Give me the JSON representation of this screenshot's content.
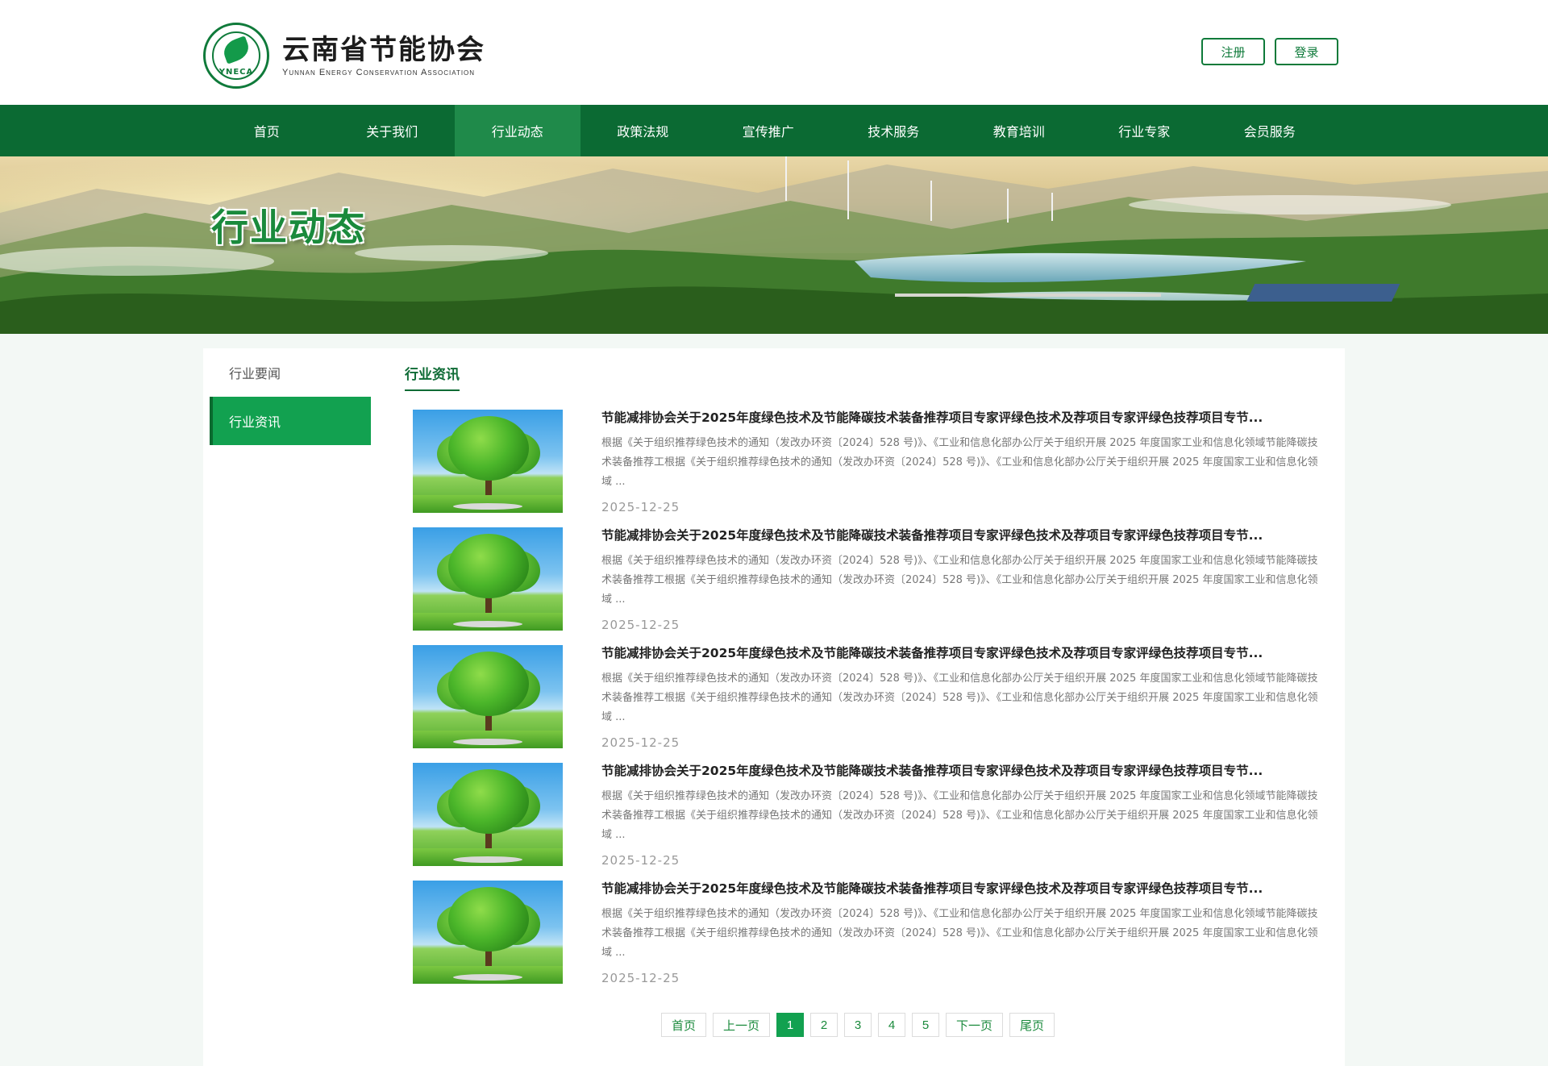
{
  "header": {
    "org_name": "云南省节能协会",
    "org_name_en": "Yunnan Energy Conservation Association",
    "seal_abbr": "YNECA",
    "seal_text": "云南省节能协会",
    "register_label": "注册",
    "login_label": "登录"
  },
  "nav": {
    "items": [
      {
        "label": "首页"
      },
      {
        "label": "关于我们"
      },
      {
        "label": "行业动态"
      },
      {
        "label": "政策法规"
      },
      {
        "label": "宣传推广"
      },
      {
        "label": "技术服务"
      },
      {
        "label": "教育培训"
      },
      {
        "label": "行业专家"
      },
      {
        "label": "会员服务"
      }
    ],
    "active_index": 2
  },
  "banner": {
    "title": "行业动态"
  },
  "sidebar": {
    "items": [
      {
        "label": "行业要闻"
      },
      {
        "label": "行业资讯"
      }
    ],
    "active_index": 1
  },
  "main": {
    "section_title": "行业资讯",
    "articles": [
      {
        "title": "节能减排协会关于2025年度绿色技术及节能降碳技术装备推荐项目专家评绿色技术及荐项目专家评绿色技荐项目专节...",
        "summary": "根据《关于组织推荐绿色技术的通知（发改办环资〔2024〕528 号)》、《工业和信息化部办公厅关于组织开展 2025 年度国家工业和信息化领域节能降碳技术装备推荐工根据《关于组织推荐绿色技术的通知（发改办环资〔2024〕528 号)》、《工业和信息化部办公厅关于组织开展 2025 年度国家工业和信息化领域 ...",
        "date": "2025-12-25"
      },
      {
        "title": "节能减排协会关于2025年度绿色技术及节能降碳技术装备推荐项目专家评绿色技术及荐项目专家评绿色技荐项目专节...",
        "summary": "根据《关于组织推荐绿色技术的通知（发改办环资〔2024〕528 号)》、《工业和信息化部办公厅关于组织开展 2025 年度国家工业和信息化领域节能降碳技术装备推荐工根据《关于组织推荐绿色技术的通知（发改办环资〔2024〕528 号)》、《工业和信息化部办公厅关于组织开展 2025 年度国家工业和信息化领域 ...",
        "date": "2025-12-25"
      },
      {
        "title": "节能减排协会关于2025年度绿色技术及节能降碳技术装备推荐项目专家评绿色技术及荐项目专家评绿色技荐项目专节...",
        "summary": "根据《关于组织推荐绿色技术的通知（发改办环资〔2024〕528 号)》、《工业和信息化部办公厅关于组织开展 2025 年度国家工业和信息化领域节能降碳技术装备推荐工根据《关于组织推荐绿色技术的通知（发改办环资〔2024〕528 号)》、《工业和信息化部办公厅关于组织开展 2025 年度国家工业和信息化领域 ...",
        "date": "2025-12-25"
      },
      {
        "title": "节能减排协会关于2025年度绿色技术及节能降碳技术装备推荐项目专家评绿色技术及荐项目专家评绿色技荐项目专节...",
        "summary": "根据《关于组织推荐绿色技术的通知（发改办环资〔2024〕528 号)》、《工业和信息化部办公厅关于组织开展 2025 年度国家工业和信息化领域节能降碳技术装备推荐工根据《关于组织推荐绿色技术的通知（发改办环资〔2024〕528 号)》、《工业和信息化部办公厅关于组织开展 2025 年度国家工业和信息化领域 ...",
        "date": "2025-12-25"
      },
      {
        "title": "节能减排协会关于2025年度绿色技术及节能降碳技术装备推荐项目专家评绿色技术及荐项目专家评绿色技荐项目专节...",
        "summary": "根据《关于组织推荐绿色技术的通知（发改办环资〔2024〕528 号)》、《工业和信息化部办公厅关于组织开展 2025 年度国家工业和信息化领域节能降碳技术装备推荐工根据《关于组织推荐绿色技术的通知（发改办环资〔2024〕528 号)》、《工业和信息化部办公厅关于组织开展 2025 年度国家工业和信息化领域 ...",
        "date": "2025-12-25"
      }
    ]
  },
  "pager": {
    "first": "首页",
    "prev": "上一页",
    "pages": [
      "1",
      "2",
      "3",
      "4",
      "5"
    ],
    "current": "1",
    "next": "下一页",
    "last": "尾页"
  },
  "colors": {
    "brand_dark": "#0b6a33",
    "brand": "#12a150",
    "nav_active": "#1f8a4a"
  }
}
